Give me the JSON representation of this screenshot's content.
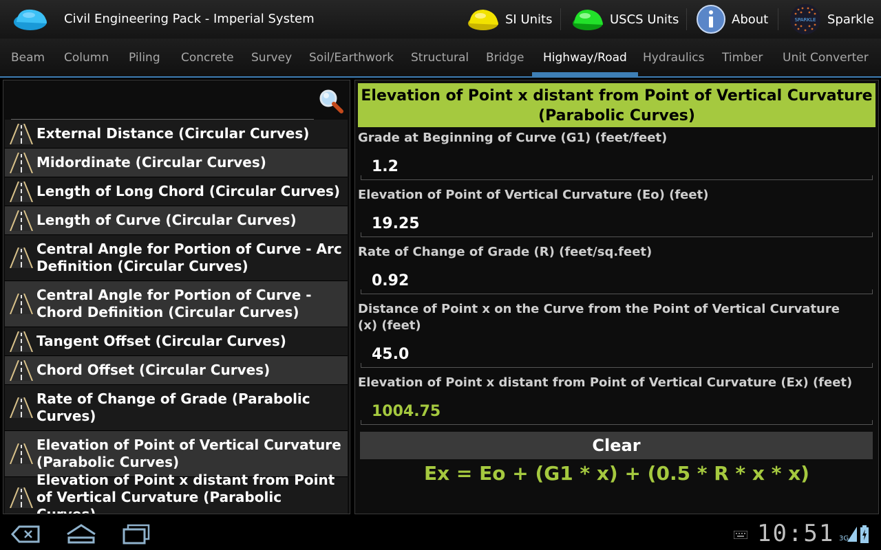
{
  "app": {
    "title": "Civil Engineering Pack - Imperial System",
    "brand_color": "#a5c93f",
    "accent_color": "#3e7fb6"
  },
  "actions": [
    {
      "label": "SI Units",
      "icon": "yellow-helmet-icon"
    },
    {
      "label": "USCS Units",
      "icon": "green-helmet-icon"
    },
    {
      "label": "About",
      "icon": "info-icon"
    },
    {
      "label": "Sparkle",
      "icon": "sparkle-logo",
      "logo_text": "SPARKLE"
    }
  ],
  "tabs": [
    {
      "label": "Beam"
    },
    {
      "label": "Column"
    },
    {
      "label": "Piling"
    },
    {
      "label": "Concrete"
    },
    {
      "label": "Survey"
    },
    {
      "label": "Soil/Earthwork"
    },
    {
      "label": "Structural"
    },
    {
      "label": "Bridge"
    },
    {
      "label": "Highway/Road",
      "active": true
    },
    {
      "label": "Hydraulics"
    },
    {
      "label": "Timber"
    },
    {
      "label": "Unit Converter"
    }
  ],
  "search": {
    "value": "",
    "placeholder": ""
  },
  "list": [
    "External Distance (Circular Curves)",
    "Midordinate (Circular Curves)",
    "Length of Long Chord (Circular Curves)",
    "Length of Curve (Circular Curves)",
    "Central Angle for Portion of Curve - Arc Definition (Circular Curves)",
    "Central Angle for Portion of Curve - Chord Definition (Circular Curves)",
    "Tangent Offset (Circular Curves)",
    "Chord Offset (Circular Curves)",
    "Rate of Change of Grade (Parabolic Curves)",
    "Elevation of Point of Vertical Curvature (Parabolic Curves)",
    "Elevation of Point x distant from Point of Vertical Curvature (Parabolic Curves)"
  ],
  "calculator": {
    "title": "Elevation of Point x distant from Point of Vertical Curvature (Parabolic Curves)",
    "fields": [
      {
        "label": "Grade at Beginning of Curve (G1) (feet/feet)",
        "value": "1.2"
      },
      {
        "label": "Elevation of Point of Vertical Curvature (Eo) (feet)",
        "value": "19.25"
      },
      {
        "label": "Rate of Change of Grade (R) (feet/sq.feet)",
        "value": "0.92"
      },
      {
        "label": "Distance of Point x on the Curve from the Point of Vertical Curvature (x) (feet)",
        "value": "45.0"
      }
    ],
    "result": {
      "label": "Elevation of Point x distant from Point of Vertical Curvature (Ex) (feet)",
      "value": "1004.75"
    },
    "clear_label": "Clear",
    "formula": "Ex = Eo + (G1 * x) + (0.5 * R * x * x)"
  },
  "system": {
    "clock": "10:51",
    "network": "3G"
  }
}
